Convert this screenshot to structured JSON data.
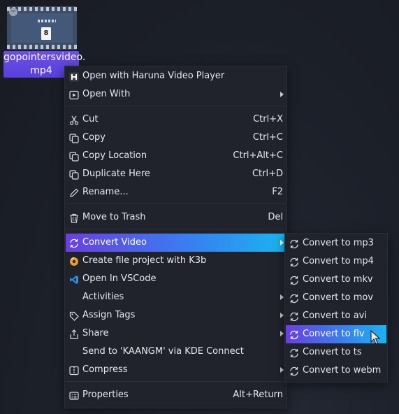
{
  "desktop_file": {
    "name": "gopointersvideo.mp4",
    "name_line1": "gopointersvideo.",
    "name_line2": "mp4",
    "thumb_digit": "8"
  },
  "context_menu": {
    "items": [
      {
        "label": "Open with Haruna Video Player",
        "shortcut": "",
        "icon": "haruna-icon"
      },
      {
        "label": "Open With",
        "shortcut": "",
        "icon": "open-with-icon"
      },
      {
        "label": "Cut",
        "shortcut": "Ctrl+X",
        "icon": "scissors-icon"
      },
      {
        "label": "Copy",
        "shortcut": "Ctrl+C",
        "icon": "copy-icon"
      },
      {
        "label": "Copy Location",
        "shortcut": "Ctrl+Alt+C",
        "icon": "copy-location-icon"
      },
      {
        "label": "Duplicate Here",
        "shortcut": "Ctrl+D",
        "icon": "duplicate-icon"
      },
      {
        "label": "Rename...",
        "shortcut": "F2",
        "icon": "pencil-icon"
      },
      {
        "label": "Move to Trash",
        "shortcut": "Del",
        "icon": "trash-icon"
      },
      {
        "label": "Convert Video",
        "shortcut": "",
        "icon": "convert-icon"
      },
      {
        "label": "Create file project with K3b",
        "shortcut": "",
        "icon": "k3b-icon"
      },
      {
        "label": "Open In VSCode",
        "shortcut": "",
        "icon": "vscode-icon"
      },
      {
        "label": "Activities",
        "shortcut": "",
        "icon": "activities-icon"
      },
      {
        "label": "Assign Tags",
        "shortcut": "",
        "icon": "tag-icon"
      },
      {
        "label": "Share",
        "shortcut": "",
        "icon": "share-icon"
      },
      {
        "label": "Send to 'KAANGM' via KDE Connect",
        "shortcut": "",
        "icon": ""
      },
      {
        "label": "Compress",
        "shortcut": "",
        "icon": "archive-icon"
      },
      {
        "label": "Properties",
        "shortcut": "Alt+Return",
        "icon": "properties-icon"
      }
    ]
  },
  "convert_submenu": {
    "items": [
      {
        "label": "Convert to mp3"
      },
      {
        "label": "Convert to mp4"
      },
      {
        "label": "Convert to mkv"
      },
      {
        "label": "Convert to mov"
      },
      {
        "label": "Convert to avi"
      },
      {
        "label": "Convert to flv"
      },
      {
        "label": "Convert to ts"
      },
      {
        "label": "Convert to webm"
      }
    ]
  },
  "colors": {
    "highlight_start": "#6a3fe0",
    "highlight_end": "#1ab4f0",
    "menu_bg": "#20232b",
    "desktop_bg": "#1c2029"
  }
}
